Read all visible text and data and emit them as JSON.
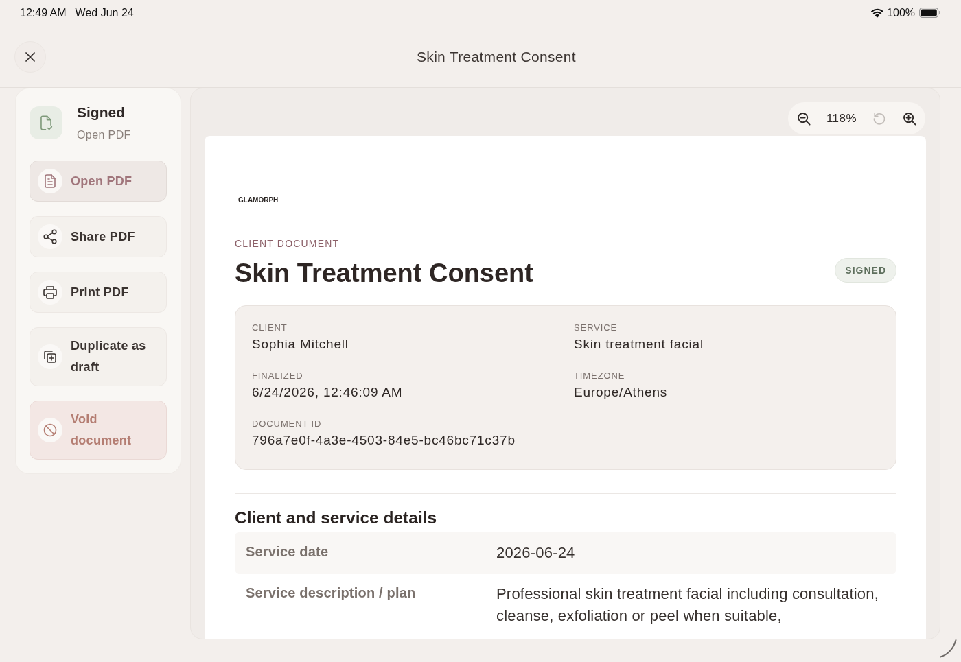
{
  "status_bar": {
    "time": "12:49 AM",
    "date": "Wed Jun 24",
    "battery": "100%"
  },
  "header": {
    "title": "Skin Treatment Consent"
  },
  "sidebar": {
    "status": {
      "title": "Signed",
      "subtitle": "Open PDF"
    },
    "actions": [
      {
        "label": "Open PDF",
        "kind": "open",
        "selected": true
      },
      {
        "label": "Share PDF",
        "kind": "share",
        "selected": false
      },
      {
        "label": "Print PDF",
        "kind": "print",
        "selected": false
      },
      {
        "label": "Duplicate as draft",
        "kind": "duplicate",
        "selected": false
      },
      {
        "label": "Void document",
        "kind": "void",
        "selected": false
      }
    ]
  },
  "viewer": {
    "zoom_level": "118%",
    "reset": {
      "disabled": true
    }
  },
  "document": {
    "brand": "GLAMORPH",
    "eyebrow": "CLIENT DOCUMENT",
    "title": "Skin Treatment Consent",
    "status_badge": "SIGNED",
    "summary": [
      {
        "label": "CLIENT",
        "value": "Sophia Mitchell"
      },
      {
        "label": "SERVICE",
        "value": "Skin treatment facial"
      },
      {
        "label": "FINALIZED",
        "value": "6/24/2026, 12:46:09 AM"
      },
      {
        "label": "TIMEZONE",
        "value": "Europe/Athens"
      },
      {
        "label": "DOCUMENT ID",
        "value": "796a7e0f-4a3e-4503-84e5-bc46bc71c37b"
      }
    ],
    "details": {
      "heading": "Client and service details",
      "rows": [
        {
          "label": "Service date",
          "value": "2026-06-24"
        },
        {
          "label": "Service description / plan",
          "value": "Professional skin treatment facial including consultation, cleanse, exfoliation or peel when suitable,"
        }
      ]
    }
  }
}
